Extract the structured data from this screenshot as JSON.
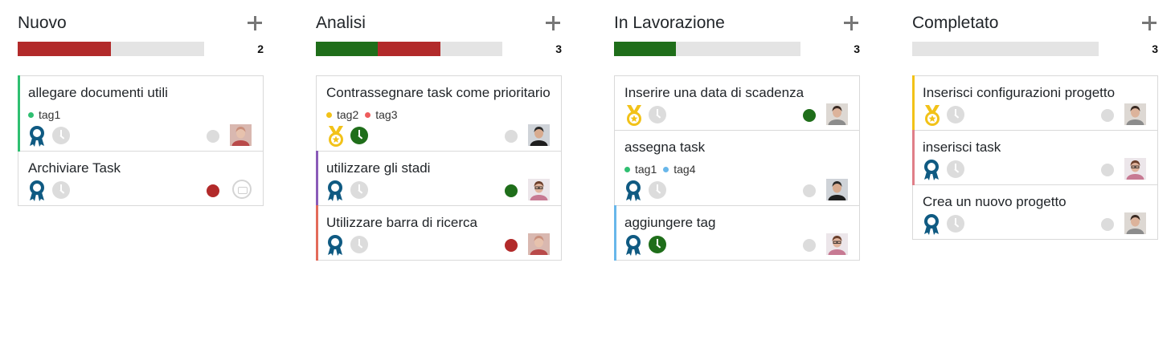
{
  "colors": {
    "red": "#b22a2a",
    "green": "#1f6e1a",
    "grey_track": "#e4e4e4",
    "dot_off": "#dcdcdc",
    "tag_green": "#2fbf71",
    "tag_yellow": "#f2c218",
    "tag_red": "#ee5c5c",
    "tag_blue": "#68b7ea",
    "stripe_green": "#2fbf71",
    "stripe_purple": "#8a5bb8",
    "stripe_salmon": "#e36b5a",
    "stripe_blue": "#68b7ea",
    "stripe_yellow": "#f2c218",
    "stripe_pink": "#e07f88",
    "blue_medal": "#0f5a82",
    "gold_medal": "#f2c218"
  },
  "columns": [
    {
      "title": "Nuovo",
      "count": "2",
      "progress": [
        {
          "color": "#b22a2a",
          "fraction": 0.5
        }
      ],
      "cards": [
        {
          "title": "allegare documenti utili",
          "stripe": "#2fbf71",
          "tags": [
            {
              "label": "tag1",
              "color": "#2fbf71"
            }
          ],
          "priority": "blue",
          "clock": "off",
          "status": "#dcdcdc",
          "avatar": "woman-curly"
        },
        {
          "title": "Archiviare Task",
          "stripe": "",
          "tags": [],
          "priority": "blue",
          "clock": "off",
          "status": "#b22a2a",
          "avatar": "none"
        }
      ]
    },
    {
      "title": "Analisi",
      "count": "3",
      "progress": [
        {
          "color": "#1f6e1a",
          "fraction": 0.333
        },
        {
          "color": "#b22a2a",
          "fraction": 0.333
        }
      ],
      "cards": [
        {
          "title": "Contrassegnare task come prioritario",
          "stripe": "",
          "tags": [
            {
              "label": "tag2",
              "color": "#f2c218"
            },
            {
              "label": "tag3",
              "color": "#ee5c5c"
            }
          ],
          "priority": "gold",
          "clock": "on",
          "status": "#dcdcdc",
          "avatar": "man-dark"
        },
        {
          "title": "utilizzare gli stadi",
          "stripe": "#8a5bb8",
          "tags": [],
          "priority": "blue",
          "clock": "off",
          "status": "#1f6e1a",
          "avatar": "man-glasses"
        },
        {
          "title": "Utilizzare barra di ricerca",
          "stripe": "#e36b5a",
          "tags": [],
          "priority": "blue",
          "clock": "off",
          "status": "#b22a2a",
          "avatar": "woman-curly"
        }
      ]
    },
    {
      "title": "In Lavorazione",
      "count": "3",
      "progress": [
        {
          "color": "#1f6e1a",
          "fraction": 0.333
        }
      ],
      "cards": [
        {
          "title": "Inserire una data di scadenza",
          "stripe": "",
          "tags": [],
          "priority": "gold",
          "clock": "off",
          "status": "#1f6e1a",
          "avatar": "woman-dark"
        },
        {
          "title": "assegna task",
          "stripe": "",
          "tags": [
            {
              "label": "tag1",
              "color": "#2fbf71"
            },
            {
              "label": "tag4",
              "color": "#68b7ea"
            }
          ],
          "priority": "blue",
          "clock": "off",
          "status": "#dcdcdc",
          "avatar": "man-dark"
        },
        {
          "title": "aggiungere tag",
          "stripe": "#68b7ea",
          "tags": [],
          "priority": "blue",
          "clock": "on",
          "status": "#dcdcdc",
          "avatar": "man-glasses"
        }
      ]
    },
    {
      "title": "Completato",
      "count": "3",
      "progress": [],
      "cards": [
        {
          "title": "Inserisci configurazioni progetto",
          "stripe": "#f2c218",
          "tags": [],
          "priority": "gold",
          "clock": "off",
          "status": "#dcdcdc",
          "avatar": "woman-dark"
        },
        {
          "title": "inserisci task",
          "stripe": "#e07f88",
          "tags": [],
          "priority": "blue",
          "clock": "off",
          "status": "#dcdcdc",
          "avatar": "man-glasses"
        },
        {
          "title": "Crea un nuovo progetto",
          "stripe": "",
          "tags": [],
          "priority": "blue",
          "clock": "off",
          "status": "#dcdcdc",
          "avatar": "woman-dark"
        }
      ]
    }
  ]
}
